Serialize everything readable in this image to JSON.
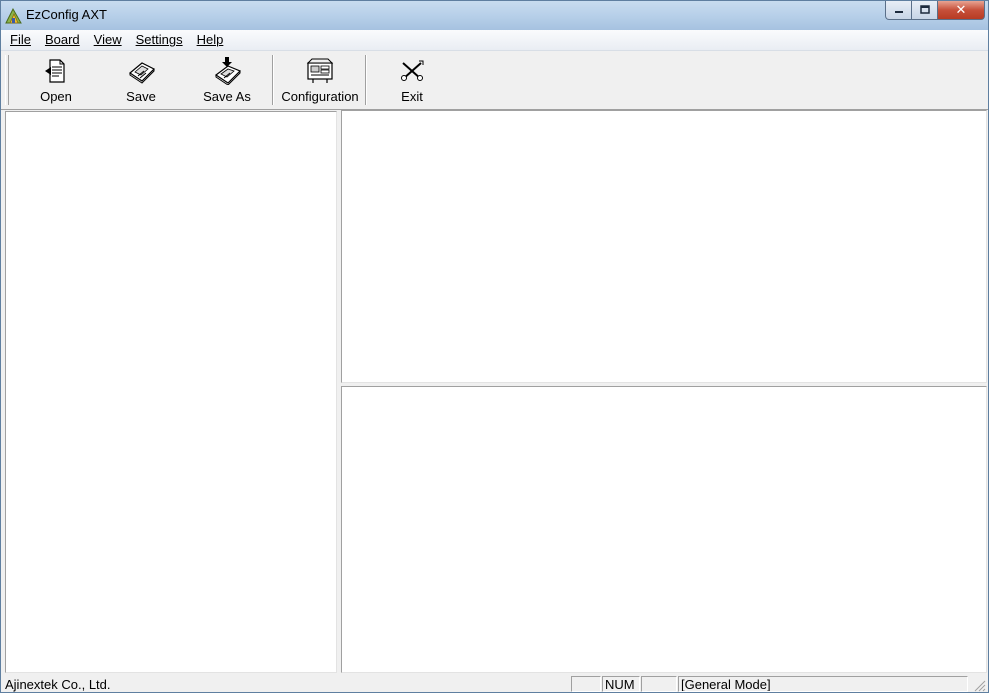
{
  "window": {
    "title": "EzConfig AXT",
    "minimize_symbol": "–",
    "maximize_symbol": "□",
    "close_symbol": "✕",
    "app_icon": "ezconfig-app-icon"
  },
  "menubar": {
    "items": [
      "File",
      "Board",
      "View",
      "Settings",
      "Help"
    ]
  },
  "toolbar": {
    "buttons": [
      {
        "label": "Open",
        "icon": "open-document-icon"
      },
      {
        "label": "Save",
        "icon": "save-disk-icon"
      },
      {
        "label": "Save As",
        "icon": "save-as-disk-icon"
      },
      {
        "label": "Configuration",
        "icon": "configuration-icon"
      },
      {
        "label": "Exit",
        "icon": "exit-icon"
      }
    ]
  },
  "statusbar": {
    "company": "Ajinextek Co., Ltd.",
    "caps": "",
    "num": "NUM",
    "scroll": "",
    "mode": "[General Mode]"
  }
}
